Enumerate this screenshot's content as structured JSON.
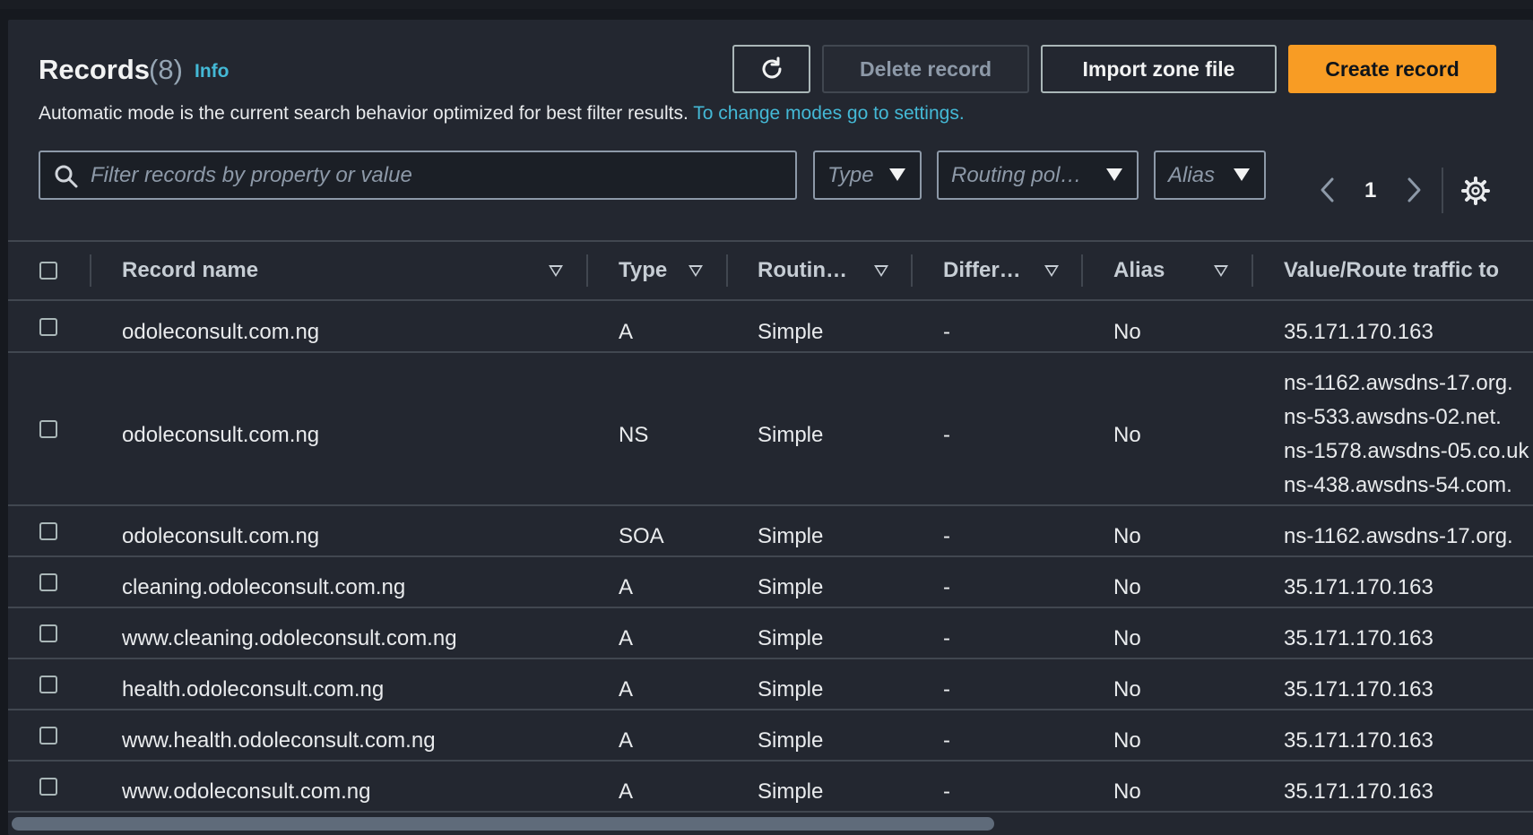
{
  "header": {
    "title": "Records",
    "count": "(8)",
    "info_label": "Info"
  },
  "buttons": {
    "refresh_icon": "refresh-icon",
    "delete_label": "Delete record",
    "import_label": "Import zone file",
    "create_label": "Create record"
  },
  "mode_notice": {
    "text": "Automatic mode is the current search behavior optimized for best filter results.",
    "link": "To change modes go to settings."
  },
  "filters": {
    "search_placeholder": "Filter records by property or value",
    "type_label": "Type",
    "routing_label": "Routing pol…",
    "alias_label": "Alias"
  },
  "pagination": {
    "current_page": "1"
  },
  "colors": {
    "accent": "#f89c24",
    "link": "#44b9d6",
    "panel_bg": "#232730",
    "border": "#414750"
  },
  "table": {
    "columns": [
      "Record name",
      "Type",
      "Routin…",
      "Differ…",
      "Alias",
      "Value/Route traffic to"
    ],
    "rows": [
      {
        "name": "odoleconsult.com.ng",
        "type": "A",
        "routing": "Simple",
        "differ": "-",
        "alias": "No",
        "values": [
          "35.171.170.163"
        ]
      },
      {
        "name": "odoleconsult.com.ng",
        "type": "NS",
        "routing": "Simple",
        "differ": "-",
        "alias": "No",
        "values": [
          "ns-1162.awsdns-17.org.",
          "ns-533.awsdns-02.net.",
          "ns-1578.awsdns-05.co.uk",
          "ns-438.awsdns-54.com."
        ]
      },
      {
        "name": "odoleconsult.com.ng",
        "type": "SOA",
        "routing": "Simple",
        "differ": "-",
        "alias": "No",
        "values": [
          "ns-1162.awsdns-17.org."
        ]
      },
      {
        "name": "cleaning.odoleconsult.com.ng",
        "type": "A",
        "routing": "Simple",
        "differ": "-",
        "alias": "No",
        "values": [
          "35.171.170.163"
        ]
      },
      {
        "name": "www.cleaning.odoleconsult.com.ng",
        "type": "A",
        "routing": "Simple",
        "differ": "-",
        "alias": "No",
        "values": [
          "35.171.170.163"
        ]
      },
      {
        "name": "health.odoleconsult.com.ng",
        "type": "A",
        "routing": "Simple",
        "differ": "-",
        "alias": "No",
        "values": [
          "35.171.170.163"
        ]
      },
      {
        "name": "www.health.odoleconsult.com.ng",
        "type": "A",
        "routing": "Simple",
        "differ": "-",
        "alias": "No",
        "values": [
          "35.171.170.163"
        ]
      },
      {
        "name": "www.odoleconsult.com.ng",
        "type": "A",
        "routing": "Simple",
        "differ": "-",
        "alias": "No",
        "values": [
          "35.171.170.163"
        ]
      }
    ]
  }
}
